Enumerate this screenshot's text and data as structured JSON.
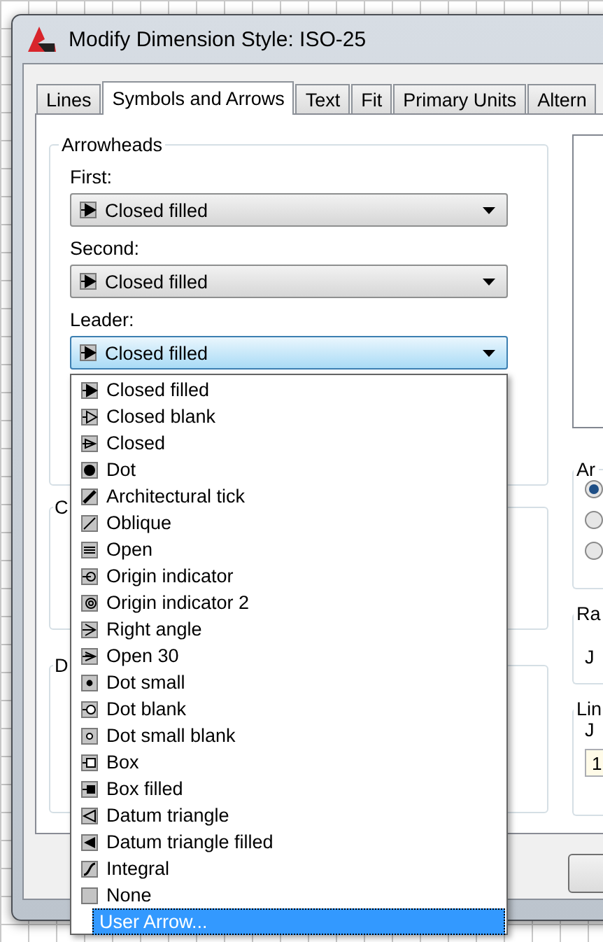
{
  "window": {
    "title": "Modify Dimension Style: ISO-25"
  },
  "tabs": [
    {
      "label": "Lines",
      "selected": false
    },
    {
      "label": "Symbols and Arrows",
      "selected": true
    },
    {
      "label": "Text",
      "selected": false
    },
    {
      "label": "Fit",
      "selected": false
    },
    {
      "label": "Primary Units",
      "selected": false
    },
    {
      "label": "Altern",
      "selected": false
    }
  ],
  "arrowheads": {
    "legend": "Arrowheads",
    "fields": [
      {
        "label": "First:",
        "value": "Closed filled",
        "focused": false
      },
      {
        "label": "Second:",
        "value": "Closed filled",
        "focused": false
      },
      {
        "label": "Leader:",
        "value": "Closed filled",
        "focused": true
      }
    ]
  },
  "group_2": {
    "legend": "C"
  },
  "group_3": {
    "legend": "D"
  },
  "group_4": {
    "legend": "Ar",
    "radios": [
      {
        "checked": true
      },
      {
        "checked": false
      },
      {
        "checked": false
      }
    ]
  },
  "group_5": {
    "legend": "Ra",
    "text": "J"
  },
  "group_6": {
    "legend": "Lin",
    "text": "J",
    "input": "1"
  },
  "dropdown": {
    "items": [
      {
        "label": "Closed filled",
        "has_icon": true,
        "selected": false
      },
      {
        "label": "Closed blank",
        "has_icon": true,
        "selected": false
      },
      {
        "label": "Closed",
        "has_icon": true,
        "selected": false
      },
      {
        "label": "Dot",
        "has_icon": true,
        "selected": false
      },
      {
        "label": "Architectural tick",
        "has_icon": true,
        "selected": false
      },
      {
        "label": "Oblique",
        "has_icon": true,
        "selected": false
      },
      {
        "label": "Open",
        "has_icon": true,
        "selected": false
      },
      {
        "label": "Origin indicator",
        "has_icon": true,
        "selected": false
      },
      {
        "label": "Origin indicator 2",
        "has_icon": true,
        "selected": false
      },
      {
        "label": "Right angle",
        "has_icon": true,
        "selected": false
      },
      {
        "label": "Open 30",
        "has_icon": true,
        "selected": false
      },
      {
        "label": "Dot small",
        "has_icon": true,
        "selected": false
      },
      {
        "label": "Dot blank",
        "has_icon": true,
        "selected": false
      },
      {
        "label": "Dot small blank",
        "has_icon": true,
        "selected": false
      },
      {
        "label": "Box",
        "has_icon": true,
        "selected": false
      },
      {
        "label": "Box filled",
        "has_icon": true,
        "selected": false
      },
      {
        "label": "Datum triangle",
        "has_icon": true,
        "selected": false
      },
      {
        "label": "Datum triangle filled",
        "has_icon": true,
        "selected": false
      },
      {
        "label": "Integral",
        "has_icon": true,
        "selected": false
      },
      {
        "label": "None",
        "has_icon": true,
        "selected": false
      },
      {
        "label": "User Arrow...",
        "has_icon": false,
        "selected": true
      }
    ]
  }
}
